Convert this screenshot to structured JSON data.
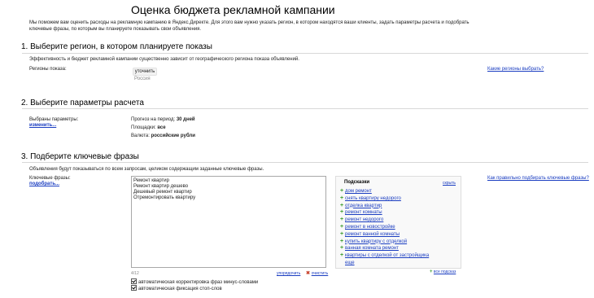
{
  "page": {
    "title": "Оценка бюджета рекламной кампании",
    "intro": "Мы поможем вам оценить расходы на рекламную кампанию в Яндекс.Директе. Для этого вам нужно указать регион, в котором находятся ваши клиенты, задать параметры расчета и подобрать ключевые фразы, по которым вы планируете показывать свои объявления."
  },
  "section1": {
    "heading": "1. Выберите регион, в котором планируете показы",
    "description": "Эффективность и бюджет рекламной кампании существенно зависит от географического региона показа объявлений.",
    "label": "Регионы показа:",
    "refine_button": "уточнить",
    "region_value": "Россия",
    "help_link": "Какие регионы выбрать?"
  },
  "section2": {
    "heading": "2. Выберите параметры расчета",
    "selected_label": "Выбраны параметры:",
    "change_link": "изменить...",
    "period_label": "Прогноз на период:",
    "period_value": "30 дней",
    "sites_label": "Площадки:",
    "sites_value": "все",
    "currency_label": "Валюта:",
    "currency_value": "российские рубли"
  },
  "section3": {
    "heading": "3. Подберите ключевые фразы",
    "description": "Объявления будут показываться по всем запросам, целиком содержащим заданные ключевые фразы.",
    "label": "Ключевые фразы:",
    "pick_link": "подобрать...",
    "keywords_text": "Ремонт квартир\nРемонт квартир дешево\nДешевый ремонт квартир\nОтремонтировать квартиру",
    "char_count": "4/12",
    "order_link": "упорядочить",
    "clear_link": "очистить",
    "help_link": "Как правильно подбирать ключевые фразы?",
    "checkbox1": "автоматическая корректировка фраз минус-словами",
    "checkbox2": "автоматическая фиксация стоп-слов"
  },
  "hints": {
    "title": "Подсказки",
    "hide_link": "скрыть",
    "items": [
      "дом ремонт",
      "снять квартиру недорого",
      "отделка квартир",
      "ремонт комнаты",
      "ремонт недорого",
      "ремонт в новостройке",
      "ремонт ванной комнаты",
      "купить квартиру с отделкой",
      "ванная комната ремонт",
      "квартиры с отделкой от застройщика"
    ],
    "more_link": "еще",
    "add_all_link": "все подсказ"
  }
}
